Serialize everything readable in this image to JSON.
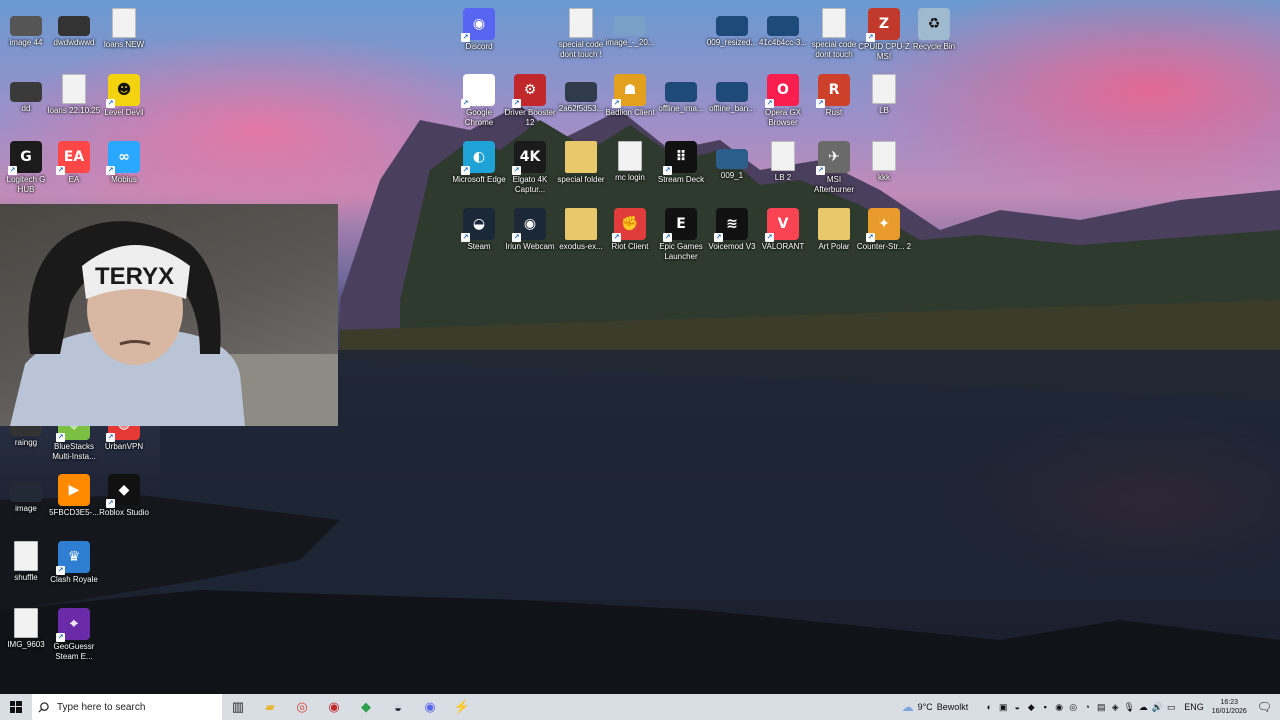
{
  "desktop": {
    "icons": [
      {
        "label": "image 44",
        "icon": "image-thumbnail-icon",
        "color": "#555555"
      },
      {
        "label": "dwdwdwwd",
        "icon": "image-thumbnail-icon",
        "color": "#333333"
      },
      {
        "label": "loans NEW",
        "icon": "document-icon",
        "color": "#f2f2f2"
      },
      {
        "label": "Discord",
        "icon": "discord-icon",
        "color": "#5865f2"
      },
      {
        "label": "special code dont touch !",
        "icon": "document-icon",
        "color": "#f2f2f2"
      },
      {
        "label": "image_-_20...",
        "icon": "image-thumbnail-icon",
        "color": "#7aa0c8"
      },
      {
        "label": "009_resized...",
        "icon": "image-thumbnail-icon",
        "color": "#1e4a7a"
      },
      {
        "label": "41c4b4cc-3...",
        "icon": "image-thumbnail-icon",
        "color": "#1e4a7a"
      },
      {
        "label": "special code dont touch",
        "icon": "document-icon",
        "color": "#f2f2f2"
      },
      {
        "label": "CPUID CPU-Z MSI",
        "icon": "cpuz-icon",
        "color": "#c0392b"
      },
      {
        "label": "Recycle Bin",
        "icon": "recycle-bin-icon",
        "color": "#9fb9cf"
      },
      {
        "label": "dd",
        "icon": "image-thumbnail-icon",
        "color": "#3a3a3a"
      },
      {
        "label": "loans 22.10.25",
        "icon": "document-icon",
        "color": "#f2f2f2"
      },
      {
        "label": "Level Devil",
        "icon": "level-devil-icon",
        "color": "#f3d20f"
      },
      {
        "label": "Google Chrome",
        "icon": "chrome-icon",
        "color": "#ffffff"
      },
      {
        "label": "Driver Booster 12",
        "icon": "driver-booster-icon",
        "color": "#c0282b"
      },
      {
        "label": "2a62f5d53...",
        "icon": "image-thumbnail-icon",
        "color": "#2f3a4a"
      },
      {
        "label": "Badlion Client",
        "icon": "badlion-icon",
        "color": "#e2a01e"
      },
      {
        "label": "offline_ima...",
        "icon": "image-thumbnail-icon",
        "color": "#1e4a7a"
      },
      {
        "label": "offline_ban...",
        "icon": "image-thumbnail-icon",
        "color": "#1e4a7a"
      },
      {
        "label": "Opera GX Browser",
        "icon": "opera-gx-icon",
        "color": "#fa1e4e"
      },
      {
        "label": "Rust",
        "icon": "rust-icon",
        "color": "#cd412b"
      },
      {
        "label": "LB",
        "icon": "document-icon",
        "color": "#f2f2f2"
      },
      {
        "label": "Logitech G HUB",
        "icon": "logitech-ghub-icon",
        "color": "#1b1b1b"
      },
      {
        "label": "EA",
        "icon": "ea-icon",
        "color": "#ff4747"
      },
      {
        "label": "Mobius",
        "icon": "mobius-icon",
        "color": "#2aa8ff"
      },
      {
        "label": "Microsoft Edge",
        "icon": "edge-icon",
        "color": "#1fa2d6"
      },
      {
        "label": "Elgato 4K Captur...",
        "icon": "elgato-icon",
        "color": "#1b1b1b"
      },
      {
        "label": "special folder",
        "icon": "folder-icon",
        "color": "#e8c86a"
      },
      {
        "label": "mc login",
        "icon": "document-icon",
        "color": "#f2f2f2"
      },
      {
        "label": "Stream Deck",
        "icon": "stream-deck-icon",
        "color": "#111111"
      },
      {
        "label": "009_1",
        "icon": "image-thumbnail-icon",
        "color": "#2c5e8c"
      },
      {
        "label": "LB 2",
        "icon": "document-icon",
        "color": "#f2f2f2"
      },
      {
        "label": "MSI Afterburner",
        "icon": "msi-afterburner-icon",
        "color": "#6a6a6a"
      },
      {
        "label": "kkk",
        "icon": "document-icon",
        "color": "#f2f2f2"
      },
      {
        "label": "Steam",
        "icon": "steam-icon",
        "color": "#1b2838"
      },
      {
        "label": "Iriun Webcam",
        "icon": "iriun-webcam-icon",
        "color": "#1b2838"
      },
      {
        "label": "exodus-ex...",
        "icon": "folder-icon",
        "color": "#e8c86a"
      },
      {
        "label": "Riot Client",
        "icon": "riot-client-icon",
        "color": "#e03c3c"
      },
      {
        "label": "Epic Games Launcher",
        "icon": "epic-games-icon",
        "color": "#111111"
      },
      {
        "label": "Voicemod V3",
        "icon": "voicemod-icon",
        "color": "#111111"
      },
      {
        "label": "VALORANT",
        "icon": "valorant-icon",
        "color": "#fa4454"
      },
      {
        "label": "Art Polar",
        "icon": "folder-icon",
        "color": "#e8c86a"
      },
      {
        "label": "Counter-Str... 2",
        "icon": "cs2-icon",
        "color": "#e89b2a"
      },
      {
        "label": "raingg",
        "icon": "image-thumbnail-icon",
        "color": "#333333"
      },
      {
        "label": "BlueStacks Multi-Insta...",
        "icon": "bluestacks-icon",
        "color": "#7bc043"
      },
      {
        "label": "UrbanVPN",
        "icon": "urbanvpn-icon",
        "color": "#e53935"
      },
      {
        "label": "image",
        "icon": "image-thumbnail-icon",
        "color": "#222a36"
      },
      {
        "label": "5FBCD3E5-...",
        "icon": "play-icon",
        "color": "#ff8a00"
      },
      {
        "label": "Roblox Studio",
        "icon": "roblox-studio-icon",
        "color": "#111111"
      },
      {
        "label": "shuffle",
        "icon": "document-icon",
        "color": "#f2f2f2"
      },
      {
        "label": "Clash Royale",
        "icon": "clash-royale-icon",
        "color": "#2e7fd1"
      },
      {
        "label": "IMG_9603",
        "icon": "document-icon",
        "color": "#f2f2f2"
      },
      {
        "label": "GeoGuessr Steam E...",
        "icon": "geoguessr-icon",
        "color": "#6b2aa8"
      }
    ],
    "icon_text": {
      "discord": "◉",
      "chrome": "◎",
      "driver": "⚙",
      "ea": "EA",
      "edge": "◐",
      "elgato": "4K",
      "streamdeck": "⠿",
      "steam": "◒",
      "epic": "EPIC",
      "roblox": "◆",
      "play": "PLAY",
      "riot": "✊",
      "voicemod": "VM",
      "valorant": "V",
      "rust": "R",
      "opera": "O"
    }
  },
  "webcam": {
    "hat_text": "TERYX"
  },
  "taskbar": {
    "search_placeholder": "Type here to search",
    "weather_temp": "9°C",
    "weather_text": "Bewolkt",
    "language": "ENG",
    "time": "16:23",
    "date": "16/01/2026",
    "pinned": [
      {
        "name": "task-view-icon",
        "glyph": "▥",
        "color": "#222222"
      },
      {
        "name": "file-explorer-icon",
        "glyph": "▰",
        "color": "#e8b73a"
      },
      {
        "name": "chrome-icon",
        "glyph": "◎",
        "color": "#db4437"
      },
      {
        "name": "driver-booster-icon",
        "glyph": "◉",
        "color": "#c0282b"
      },
      {
        "name": "app-icon",
        "glyph": "◆",
        "color": "#2e9e4f"
      },
      {
        "name": "steam-icon",
        "glyph": "◒",
        "color": "#1b2838"
      },
      {
        "name": "discord-icon",
        "glyph": "◉",
        "color": "#5865f2"
      },
      {
        "name": "app2-icon",
        "glyph": "⚡",
        "color": "#3a5fb0"
      }
    ]
  },
  "colors": {
    "taskbar_bg": "#d9dde4",
    "label_text": "#ffffff"
  }
}
